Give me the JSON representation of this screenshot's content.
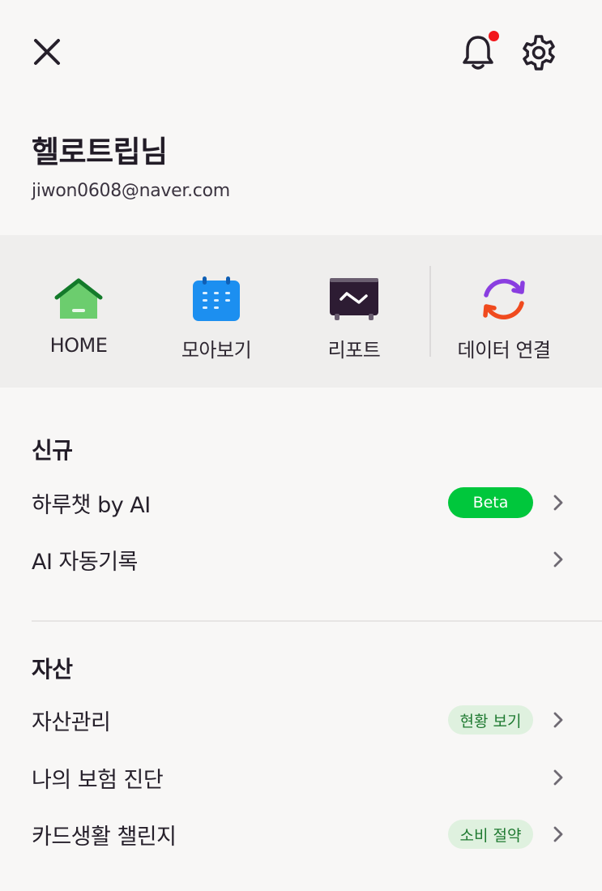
{
  "header": {
    "close_icon": "close-icon",
    "notification_icon": "bell-icon",
    "notification_dot_color": "#f2161b",
    "settings_icon": "gear-icon"
  },
  "profile": {
    "name": "헬로트립님",
    "email": "jiwon0608@naver.com"
  },
  "quick_nav": [
    {
      "label": "HOME",
      "icon": "home-icon"
    },
    {
      "label": "모아보기",
      "icon": "calendar-icon"
    },
    {
      "label": "리포트",
      "icon": "report-monitor-icon"
    },
    {
      "label": "데이터 연결",
      "icon": "sync-icon"
    }
  ],
  "sections": {
    "new": {
      "title": "신규",
      "items": [
        {
          "label": "하루챗 by AI",
          "badge": "Beta"
        },
        {
          "label": "AI 자동기록"
        }
      ]
    },
    "assets": {
      "title": "자산",
      "items": [
        {
          "label": "자산관리",
          "badge": "현황 보기"
        },
        {
          "label": "나의 보험 진단"
        },
        {
          "label": "카드생활 챌린지",
          "badge": "소비 절약"
        }
      ]
    }
  },
  "colors": {
    "accent_green": "#00c73c",
    "soft_badge_bg": "#dff1df",
    "soft_badge_text": "#1f7a31",
    "background": "#f8f7f6"
  }
}
